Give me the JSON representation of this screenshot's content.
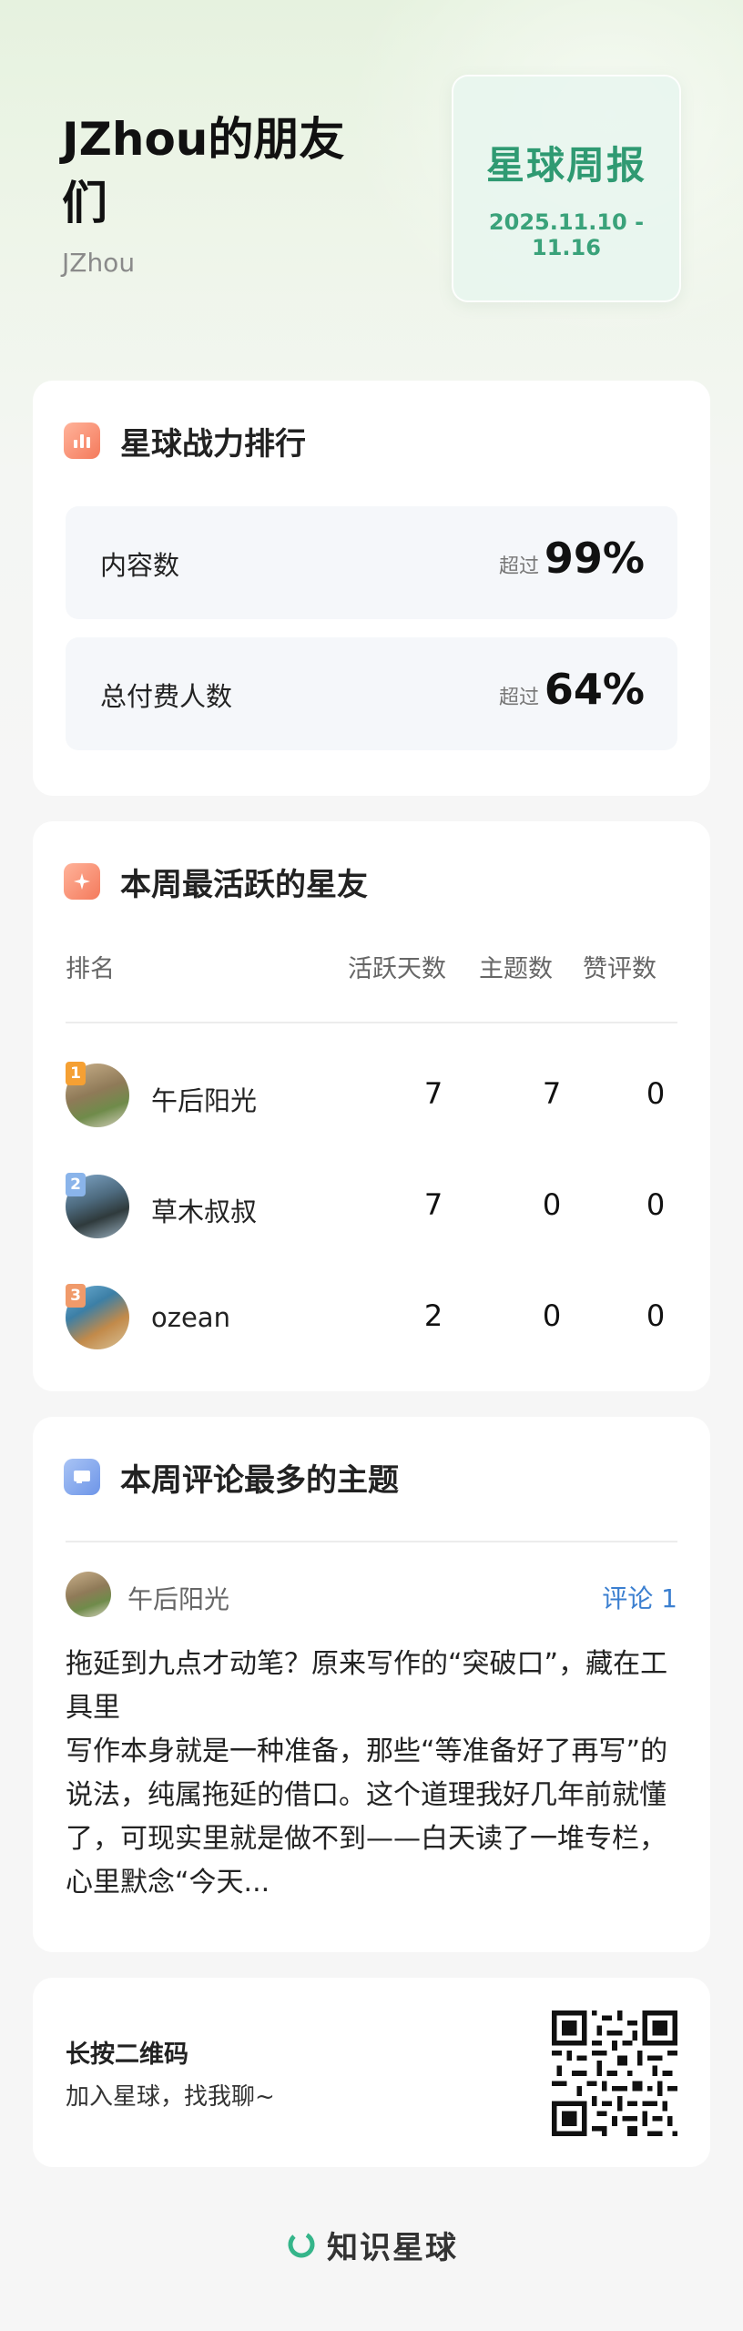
{
  "header": {
    "group_title": "JZhou的朋友们",
    "owner": "JZhou",
    "weekly_title": "星球周报",
    "weekly_dates": "2025.11.10 - 11.16"
  },
  "power_ranking": {
    "title": "星球战力排行",
    "rows": [
      {
        "label": "内容数",
        "prefix": "超过",
        "value": "99%"
      },
      {
        "label": "总付费人数",
        "prefix": "超过",
        "value": "64%"
      }
    ]
  },
  "active_members": {
    "title": "本周最活跃的星友",
    "columns": [
      "排名",
      "活跃天数",
      "主题数",
      "赞评数"
    ],
    "rows": [
      {
        "rank": "1",
        "name": "午后阳光",
        "active_days": "7",
        "topics": "7",
        "likes": "0"
      },
      {
        "rank": "2",
        "name": "草木叔叔",
        "active_days": "7",
        "topics": "0",
        "likes": "0"
      },
      {
        "rank": "3",
        "name": "ozean",
        "active_days": "2",
        "topics": "0",
        "likes": "0"
      }
    ]
  },
  "top_topic": {
    "title": "本周评论最多的主题",
    "author": "午后阳光",
    "comments": "评论 1",
    "body": "拖延到九点才动笔？原来写作的“突破口”，藏在工具里\n写作本身就是一种准备，那些“等准备好了再写”的说法，纯属拖延的借口。这个道理我好几年前就懂了，可现实里就是做不到——白天读了一堆专栏，心里默念“今天..."
  },
  "join": {
    "title": "长按二维码",
    "subtitle": "加入星球，找我聊~"
  },
  "footer": {
    "brand": "知识星球"
  },
  "colors": {
    "accent_green": "#2f9a72",
    "link_blue": "#3b7fd0",
    "rank_icon": "#f58a6c",
    "medal_gold": "#f5a033",
    "medal_silver": "#8ab4ea",
    "medal_bronze": "#f09a6a"
  },
  "icons": [
    "bar-chart-icon",
    "sparkle-icon",
    "message-icon",
    "qr-code",
    "brand-logo-icon"
  ]
}
